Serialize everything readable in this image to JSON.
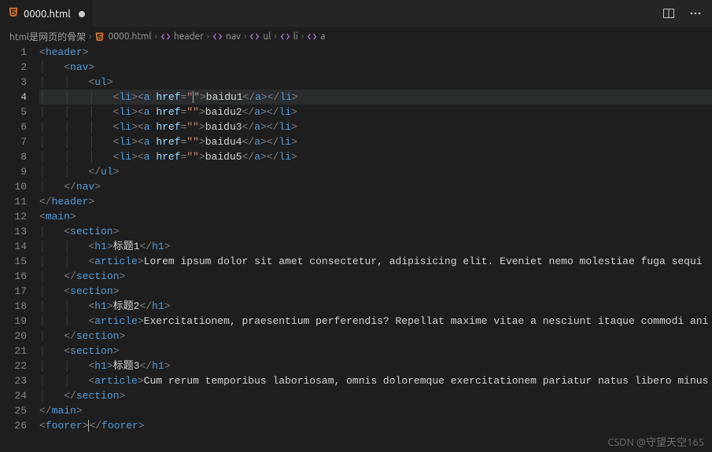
{
  "tab": {
    "title": "0000.html",
    "dirty": true
  },
  "breadcrumb": {
    "root": "html是网页的骨架",
    "items": [
      "0000.html",
      "header",
      "nav",
      "ul",
      "li",
      "a"
    ]
  },
  "lines": [
    {
      "n": 1,
      "indent": 0,
      "kind": "open",
      "tag": "header"
    },
    {
      "n": 2,
      "indent": 1,
      "kind": "open",
      "tag": "nav"
    },
    {
      "n": 3,
      "indent": 2,
      "kind": "open",
      "tag": "ul"
    },
    {
      "n": 4,
      "indent": 3,
      "kind": "li-a",
      "href": "",
      "text": "baidu1",
      "active": true,
      "cursorInHref": true
    },
    {
      "n": 5,
      "indent": 3,
      "kind": "li-a",
      "href": "",
      "text": "baidu2"
    },
    {
      "n": 6,
      "indent": 3,
      "kind": "li-a",
      "href": "",
      "text": "baidu3"
    },
    {
      "n": 7,
      "indent": 3,
      "kind": "li-a",
      "href": "",
      "text": "baidu4"
    },
    {
      "n": 8,
      "indent": 3,
      "kind": "li-a",
      "href": "",
      "text": "baidu5"
    },
    {
      "n": 9,
      "indent": 2,
      "kind": "close",
      "tag": "ul"
    },
    {
      "n": 10,
      "indent": 1,
      "kind": "close",
      "tag": "nav"
    },
    {
      "n": 11,
      "indent": 0,
      "kind": "close",
      "tag": "header"
    },
    {
      "n": 12,
      "indent": 0,
      "kind": "open",
      "tag": "main"
    },
    {
      "n": 13,
      "indent": 1,
      "kind": "open",
      "tag": "section"
    },
    {
      "n": 14,
      "indent": 2,
      "kind": "h1",
      "text": "标题1"
    },
    {
      "n": 15,
      "indent": 2,
      "kind": "article",
      "text": "Lorem ipsum dolor sit amet consectetur, adipisicing elit. Eveniet nemo molestiae fuga sequi"
    },
    {
      "n": 16,
      "indent": 1,
      "kind": "close",
      "tag": "section"
    },
    {
      "n": 17,
      "indent": 1,
      "kind": "open",
      "tag": "section"
    },
    {
      "n": 18,
      "indent": 2,
      "kind": "h1",
      "text": "标题2"
    },
    {
      "n": 19,
      "indent": 2,
      "kind": "article",
      "text": "Exercitationem, praesentium perferendis? Repellat maxime vitae a nesciunt itaque commodi ani"
    },
    {
      "n": 20,
      "indent": 1,
      "kind": "close",
      "tag": "section"
    },
    {
      "n": 21,
      "indent": 1,
      "kind": "open",
      "tag": "section"
    },
    {
      "n": 22,
      "indent": 2,
      "kind": "h1",
      "text": "标题3"
    },
    {
      "n": 23,
      "indent": 2,
      "kind": "article",
      "text": "Cum rerum temporibus laboriosam, omnis doloremque exercitationem pariatur natus libero minus"
    },
    {
      "n": 24,
      "indent": 1,
      "kind": "close",
      "tag": "section"
    },
    {
      "n": 25,
      "indent": 0,
      "kind": "close",
      "tag": "main"
    },
    {
      "n": 26,
      "indent": 0,
      "kind": "foorer"
    }
  ],
  "watermark": "CSDN @守望天空165"
}
